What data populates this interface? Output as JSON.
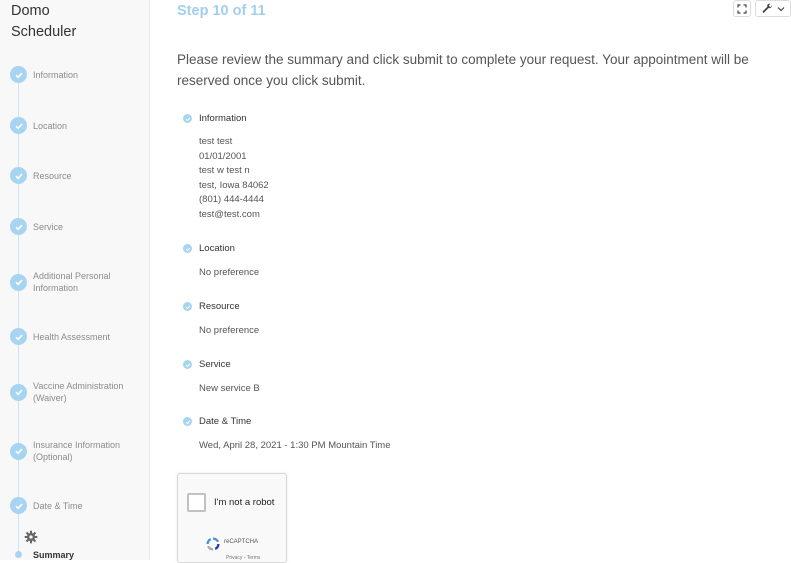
{
  "sidebar": {
    "title": "Domo\nScheduler",
    "steps": [
      {
        "label": "Information"
      },
      {
        "label": "Location"
      },
      {
        "label": "Resource"
      },
      {
        "label": "Service"
      },
      {
        "label": "Additional Personal Information"
      },
      {
        "label": "Health Assessment"
      },
      {
        "label": "Vaccine Administration (Waiver)"
      },
      {
        "label": "Insurance Information (Optional)"
      },
      {
        "label": "Date & Time"
      }
    ],
    "current_step": "Summary",
    "icons": {
      "completed": "check-circle-icon",
      "settings": "gear-icon"
    }
  },
  "main": {
    "step_title": "Step 10 of 11",
    "intro": "Please review the summary and click submit to complete your request. Your appointment will be reserved once you click submit.",
    "toolbar": {
      "icons": [
        "fullscreen-icon",
        "wrench-icon",
        "chevron-down-icon"
      ]
    },
    "sections": {
      "information": {
        "title": "Information",
        "lines": [
          "test test",
          "01/01/2001",
          "test w test n",
          "test, Iowa 84062",
          "(801) 444-4444",
          "test@test.com"
        ]
      },
      "location": {
        "title": "Location",
        "value": "No preference"
      },
      "resource": {
        "title": "Resource",
        "value": "No preference"
      },
      "service": {
        "title": "Service",
        "value": "New service B"
      },
      "datetime": {
        "title": "Date & Time",
        "value": "Wed, April 28, 2021 - 1:30 PM Mountain Time"
      }
    },
    "recaptcha": {
      "label": "I'm not a robot",
      "brand": "reCAPTCHA",
      "terms": "Privacy - Terms"
    }
  },
  "colors": {
    "accent": "#a7d4f1",
    "step_title": "#a2cfee",
    "sidebar_bg": "#f8f8f8"
  }
}
